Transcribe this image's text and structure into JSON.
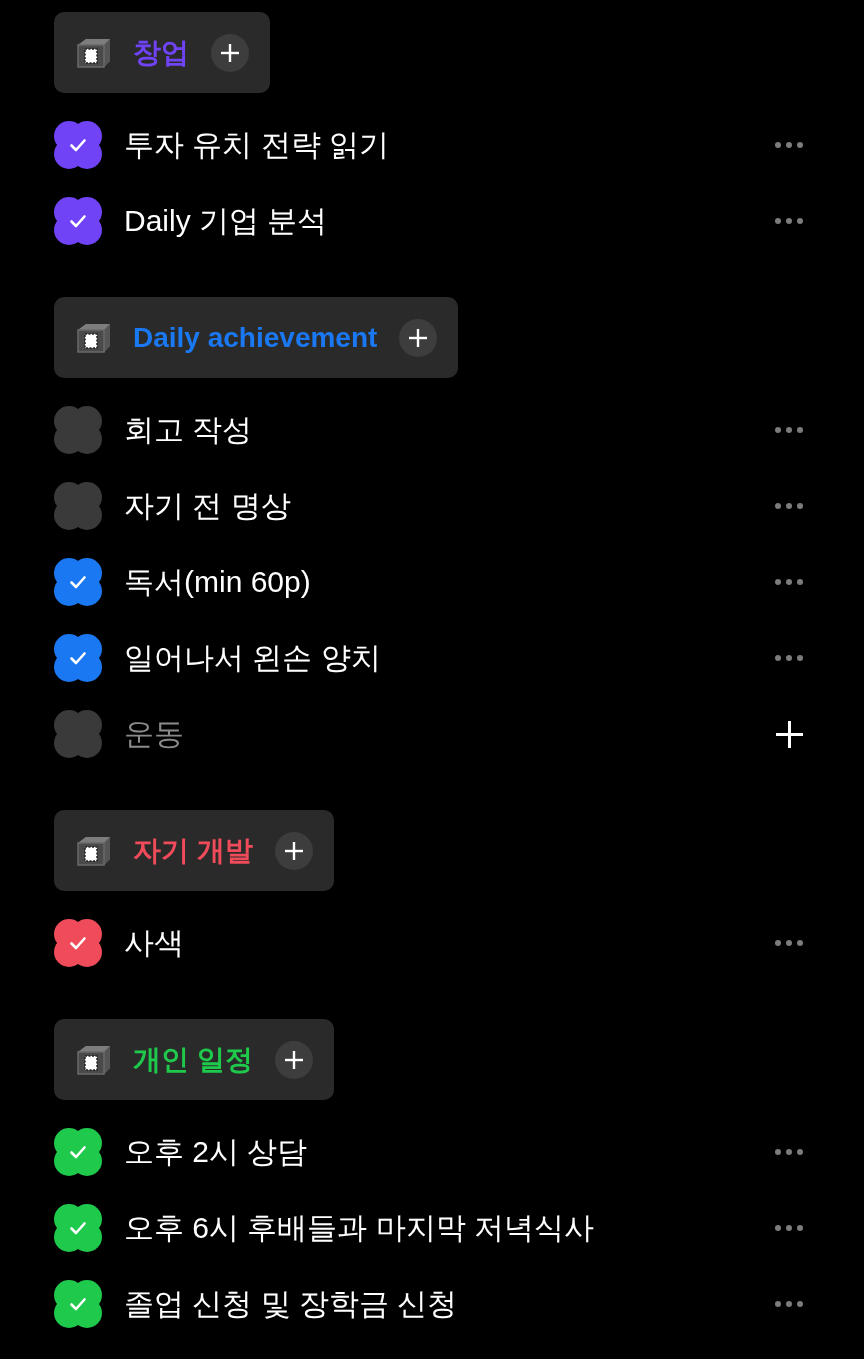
{
  "categories": [
    {
      "title": "창업",
      "color": "#7043f7",
      "items": [
        {
          "kind": "task",
          "text": "투자 유치 전략 읽기",
          "checked": true
        },
        {
          "kind": "task",
          "text": "Daily 기업 분석",
          "checked": true
        }
      ]
    },
    {
      "title": "Daily achievement",
      "color": "#1a78f2",
      "items": [
        {
          "kind": "task",
          "text": "회고 작성",
          "checked": false
        },
        {
          "kind": "task",
          "text": "자기 전 명상",
          "checked": false
        },
        {
          "kind": "task",
          "text": "독서(min 60p)",
          "checked": true
        },
        {
          "kind": "task",
          "text": "일어나서 왼손 양치",
          "checked": true
        },
        {
          "kind": "draft",
          "placeholder": "운동",
          "checked": false
        }
      ]
    },
    {
      "title": "자기 개발",
      "color": "#f04b5a",
      "items": [
        {
          "kind": "task",
          "text": "사색",
          "checked": true
        }
      ]
    },
    {
      "title": "개인 일정",
      "color": "#1ec94b",
      "items": [
        {
          "kind": "task",
          "text": "오후 2시 상담",
          "checked": true
        },
        {
          "kind": "task",
          "text": "오후 6시 후배들과 마지막 저녁식사",
          "checked": true
        },
        {
          "kind": "task",
          "text": "졸업 신청 및 장학금 신청",
          "checked": true
        }
      ]
    }
  ]
}
